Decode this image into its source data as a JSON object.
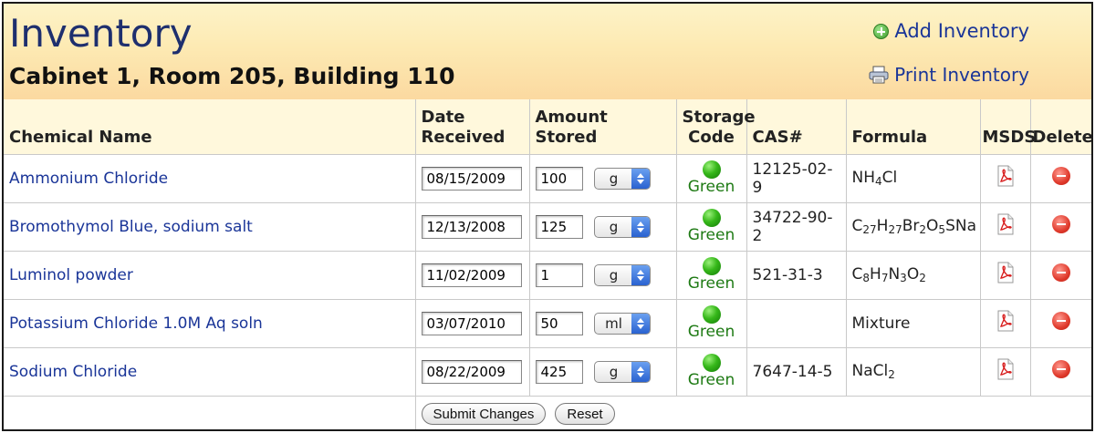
{
  "header": {
    "title": "Inventory",
    "location": "Cabinet 1, Room 205, Building 110",
    "add_label": "Add Inventory",
    "print_label": "Print Inventory"
  },
  "columns": {
    "name": "Chemical Name",
    "date_line1": "Date",
    "date_line2": "Received",
    "amount": "Amount Stored",
    "storage_line1": "Storage",
    "storage_line2": "Code",
    "cas": "CAS#",
    "formula": "Formula",
    "msds": "MSDS",
    "delete": "Delete"
  },
  "rows": [
    {
      "name": "Ammonium Chloride",
      "date": "08/15/2009",
      "amount": "100",
      "unit": "g",
      "storage": "Green",
      "cas": "12125-02-9",
      "formula": [
        [
          "NH",
          ""
        ],
        [
          "4",
          "sub"
        ],
        [
          "Cl",
          ""
        ]
      ]
    },
    {
      "name": "Bromothymol Blue, sodium salt",
      "date": "12/13/2008",
      "amount": "125",
      "unit": "g",
      "storage": "Green",
      "cas": "34722-90-2",
      "formula": [
        [
          "C",
          ""
        ],
        [
          "27",
          "sub"
        ],
        [
          "H",
          ""
        ],
        [
          "27",
          "sub"
        ],
        [
          "Br",
          ""
        ],
        [
          "2",
          "sub"
        ],
        [
          "O",
          ""
        ],
        [
          "5",
          "sub"
        ],
        [
          "SNa",
          ""
        ]
      ]
    },
    {
      "name": "Luminol powder",
      "date": "11/02/2009",
      "amount": "1",
      "unit": "g",
      "storage": "Green",
      "cas": "521-31-3",
      "formula": [
        [
          "C",
          ""
        ],
        [
          "8",
          "sub"
        ],
        [
          "H",
          ""
        ],
        [
          "7",
          "sub"
        ],
        [
          "N",
          ""
        ],
        [
          "3",
          "sub"
        ],
        [
          "O",
          ""
        ],
        [
          "2",
          "sub"
        ]
      ]
    },
    {
      "name": "Potassium Chloride 1.0M Aq soln",
      "date": "03/07/2010",
      "amount": "50",
      "unit": "ml",
      "storage": "Green",
      "cas": "",
      "formula": [
        [
          "Mixture",
          ""
        ]
      ]
    },
    {
      "name": "Sodium Chloride",
      "date": "08/22/2009",
      "amount": "425",
      "unit": "g",
      "storage": "Green",
      "cas": "7647-14-5",
      "formula": [
        [
          "NaCl",
          ""
        ],
        [
          "2",
          "sub"
        ]
      ]
    }
  ],
  "buttons": {
    "submit": "Submit Changes",
    "reset": "Reset"
  },
  "colors": {
    "link": "#1a3598",
    "title": "#1e2f6e",
    "storage_green": "#1e7a14",
    "header_bg": "#fdeab3"
  },
  "icons": {
    "add": "plus-circle-icon",
    "print": "printer-icon",
    "msds": "pdf-icon",
    "delete": "minus-circle-icon",
    "storage": "green-dot-icon"
  }
}
